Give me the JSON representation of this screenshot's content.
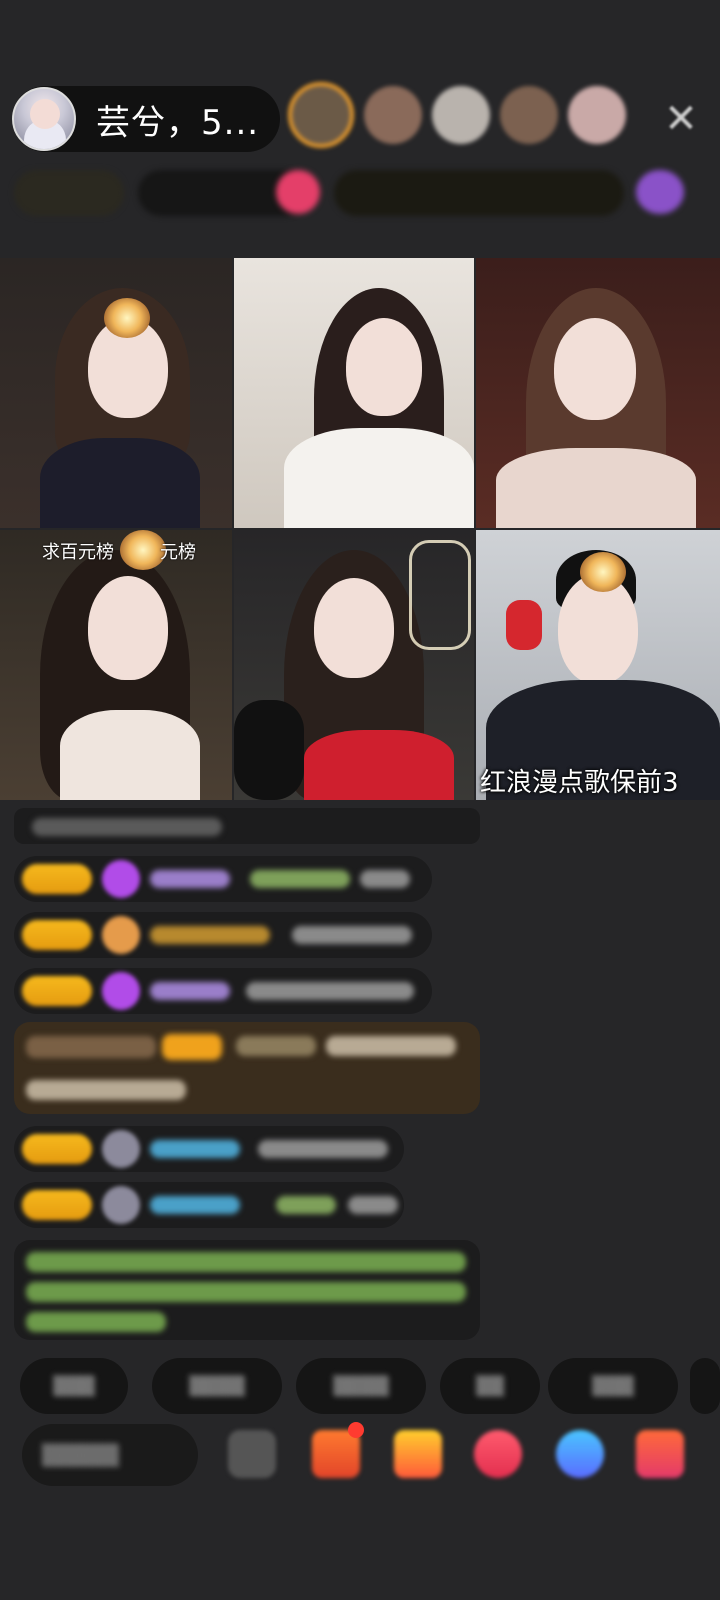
{
  "host": {
    "name": "芸兮，5..."
  },
  "tiles": {
    "t4_caption": "求百元榜",
    "t4_caption_right": "元榜",
    "t6_caption": "红浪漫点歌保前3"
  },
  "colors": {
    "background": "#262628",
    "badge_gold": "#f6b91d",
    "accent_orange": "#e69a2d"
  },
  "icons": [
    "close-icon",
    "gift-icon",
    "share-icon",
    "more-icon"
  ]
}
